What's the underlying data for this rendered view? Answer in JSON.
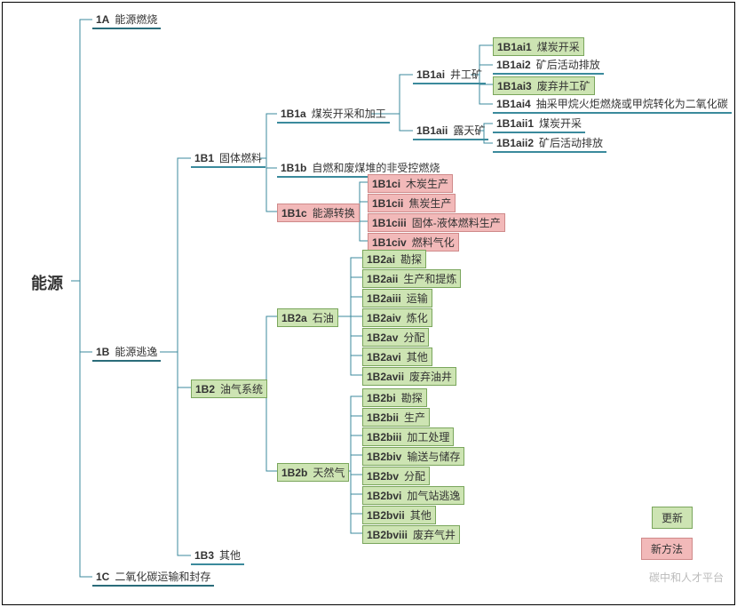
{
  "root": "能源",
  "top": {
    "a": {
      "code": "1A",
      "label": "能源燃烧"
    },
    "b": {
      "code": "1B",
      "label": "能源逃逸"
    },
    "c": {
      "code": "1C",
      "label": "二氧化碳运输和封存"
    }
  },
  "b1": {
    "code": "1B1",
    "label": "固体燃料"
  },
  "b2": {
    "code": "1B2",
    "label": "油气系统"
  },
  "b3": {
    "code": "1B3",
    "label": "其他"
  },
  "b1a": {
    "code": "1B1a",
    "label": "煤炭开采和加工"
  },
  "b1b": {
    "code": "1B1b",
    "label": "自燃和废煤堆的非受控燃烧"
  },
  "b1c": {
    "code": "1B1c",
    "label": "能源转换"
  },
  "b1ai": {
    "code": "1B1ai",
    "label": "井工矿"
  },
  "b1aii": {
    "code": "1B1aii",
    "label": "露天矿"
  },
  "b1ai1": {
    "code": "1B1ai1",
    "label": "煤炭开采"
  },
  "b1ai2": {
    "code": "1B1ai2",
    "label": "矿后活动排放"
  },
  "b1ai3": {
    "code": "1B1ai3",
    "label": "废弃井工矿"
  },
  "b1ai4": {
    "code": "1B1ai4",
    "label": "抽采甲烷火炬燃烧或甲烷转化为二氧化碳"
  },
  "b1aii1": {
    "code": "1B1aii1",
    "label": "煤炭开采"
  },
  "b1aii2": {
    "code": "1B1aii2",
    "label": "矿后活动排放"
  },
  "b1ci": {
    "code": "1B1ci",
    "label": "木炭生产"
  },
  "b1cii": {
    "code": "1B1cii",
    "label": "焦炭生产"
  },
  "b1ciii": {
    "code": "1B1ciii",
    "label": "固体-液体燃料生产"
  },
  "b1civ": {
    "code": "1B1civ",
    "label": "燃料气化"
  },
  "b2a": {
    "code": "1B2a",
    "label": "石油"
  },
  "b2b": {
    "code": "1B2b",
    "label": "天然气"
  },
  "b2ai": {
    "code": "1B2ai",
    "label": "勘探"
  },
  "b2aii": {
    "code": "1B2aii",
    "label": "生产和提炼"
  },
  "b2aiii": {
    "code": "1B2aiii",
    "label": "运输"
  },
  "b2aiv": {
    "code": "1B2aiv",
    "label": "炼化"
  },
  "b2av": {
    "code": "1B2av",
    "label": "分配"
  },
  "b2avi": {
    "code": "1B2avi",
    "label": "其他"
  },
  "b2avii": {
    "code": "1B2avii",
    "label": "废弃油井"
  },
  "b2bi": {
    "code": "1B2bi",
    "label": "勘探"
  },
  "b2bii": {
    "code": "1B2bii",
    "label": "生产"
  },
  "b2biii": {
    "code": "1B2biii",
    "label": "加工处理"
  },
  "b2biv": {
    "code": "1B2biv",
    "label": "输送与储存"
  },
  "b2bv": {
    "code": "1B2bv",
    "label": "分配"
  },
  "b2bvi": {
    "code": "1B2bvi",
    "label": "加气站逃逸"
  },
  "b2bvii": {
    "code": "1B2bvii",
    "label": "其他"
  },
  "b2bviii": {
    "code": "1B2bviii",
    "label": "废弃气井"
  },
  "legend": {
    "update": "更新",
    "new": "新方法"
  },
  "watermark": "碳中和人才平台"
}
